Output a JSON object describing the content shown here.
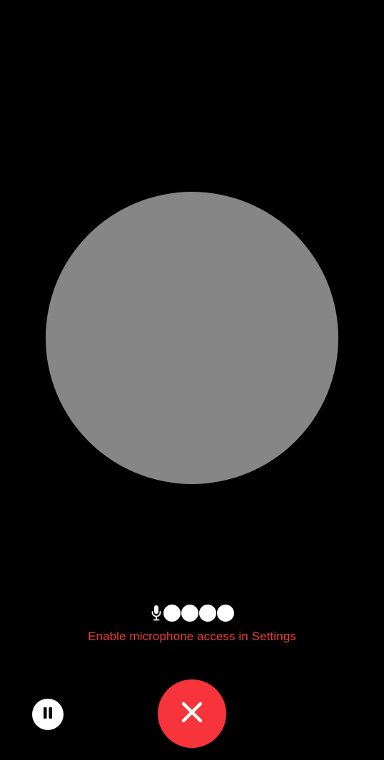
{
  "colors": {
    "background": "#000000",
    "orb": "#868686",
    "status_text": "#ee3b3b",
    "end_button": "#f7333b",
    "pause_button": "#ffffff"
  },
  "voice": {
    "mic_icon": "microphone-icon",
    "level_dots_count": 4,
    "status_message": "Enable microphone access in Settings"
  },
  "controls": {
    "pause_icon": "pause-icon",
    "end_icon": "close-icon"
  }
}
